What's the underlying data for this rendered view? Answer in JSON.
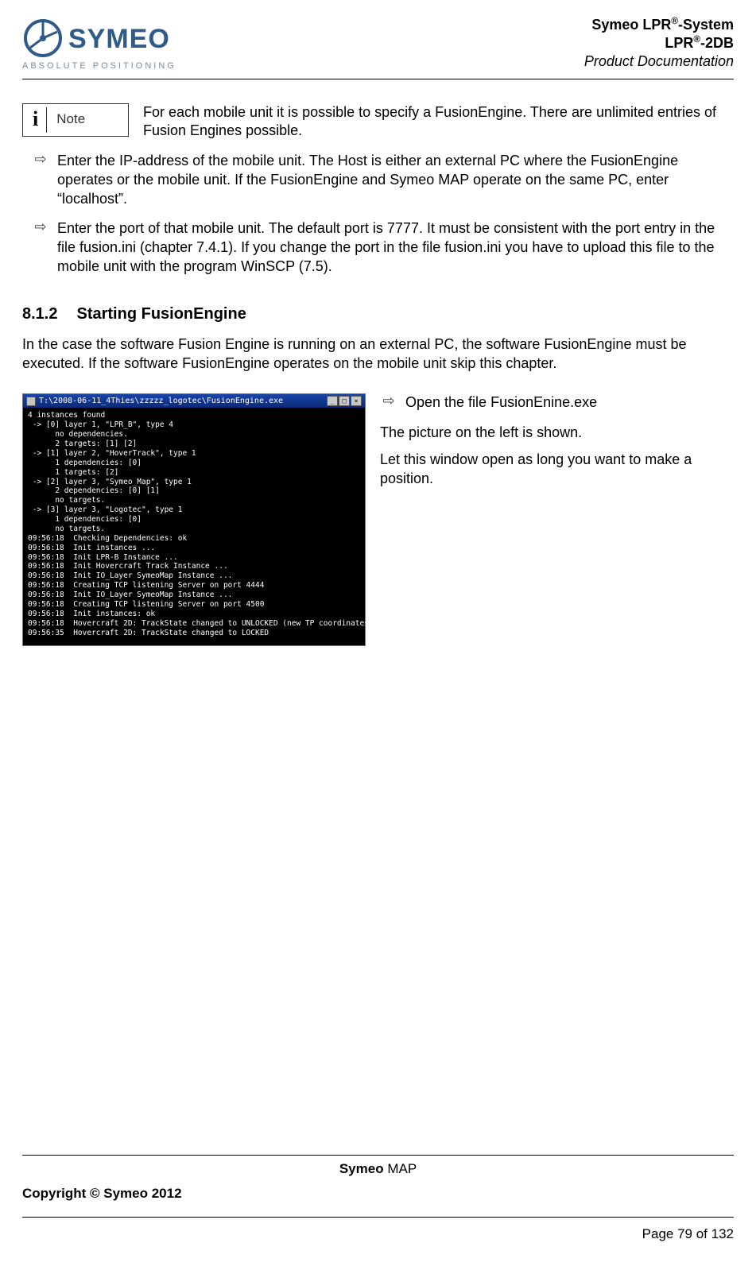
{
  "header": {
    "logo_tagline": "ABSOLUTE POSITIONING",
    "line1_a": "Symeo LPR",
    "line1_b": "-System",
    "line2_a": "LPR",
    "line2_b": "-2DB",
    "line3": "Product Documentation"
  },
  "note": {
    "badge_i": "i",
    "badge_label": "Note",
    "text": "For each mobile unit it is possible to specify a FusionEngine. There are unlimited entries of Fusion Engines possible."
  },
  "arrows_top": [
    "Enter the IP-address of the mobile unit. The Host is either an external PC where the FusionEngine operates or the mobile unit. If the FusionEngine and Symeo MAP operate on the same PC, enter “localhost”.",
    "Enter the port of that mobile unit. The default port is 7777. It must be consistent with the port entry in the file fusion.ini (chapter 7.4.1). If you change the port in the file fusion.ini you have to upload this file to the mobile unit with the program WinSCP (7.5)."
  ],
  "section": {
    "number": "8.1.2",
    "title": "Starting FusionEngine",
    "intro": "In the case the software Fusion Engine is running on an external PC, the software FusionEngine must be executed. If the software FusionEngine operates on the mobile unit skip this chapter."
  },
  "console": {
    "title": "T:\\2008-06-11_4Thies\\zzzzz_logotec\\FusionEngine.exe",
    "body": "4 instances found\n -> [0] layer 1, \"LPR_B\", type 4\n      no dependencies.\n      2 targets: [1] [2]\n -> [1] layer 2, \"HoverTrack\", type 1\n      1 dependencies: [0]\n      1 targets: [2]\n -> [2] layer 3, \"Symeo_Map\", type 1\n      2 dependencies: [0] [1]\n      no targets.\n -> [3] layer 3, \"Logotec\", type 1\n      1 dependencies: [0]\n      no targets.\n09:56:18  Checking Dependencies: ok\n09:56:18  Init instances ...\n09:56:18  Init LPR-B Instance ...\n09:56:18  Init Hovercraft Track Instance ...\n09:56:18  Init IO_Layer SymeoMap Instance ...\n09:56:18  Creating TCP listening Server on port 4444\n09:56:18  Init IO_Layer SymeoMap Instance ...\n09:56:18  Creating TCP listening Server on port 4500\n09:56:18  Init instances: ok\n09:56:18  Hovercraft 2D: TrackState changed to UNLOCKED (new TP coordinates)\n09:56:35  Hovercraft 2D: TrackState changed to LOCKED"
  },
  "right_col": {
    "arrow": "Open the file FusionEnine.exe",
    "p1": "The picture on the left is shown.",
    "p2": "Let this window open as long you want to make a position."
  },
  "footer": {
    "product_a": "Symeo",
    "product_b": " MAP",
    "copyright": "Copyright © Symeo 2012",
    "page": "Page 79 of 132"
  },
  "glyphs": {
    "arrow": "⇨"
  }
}
